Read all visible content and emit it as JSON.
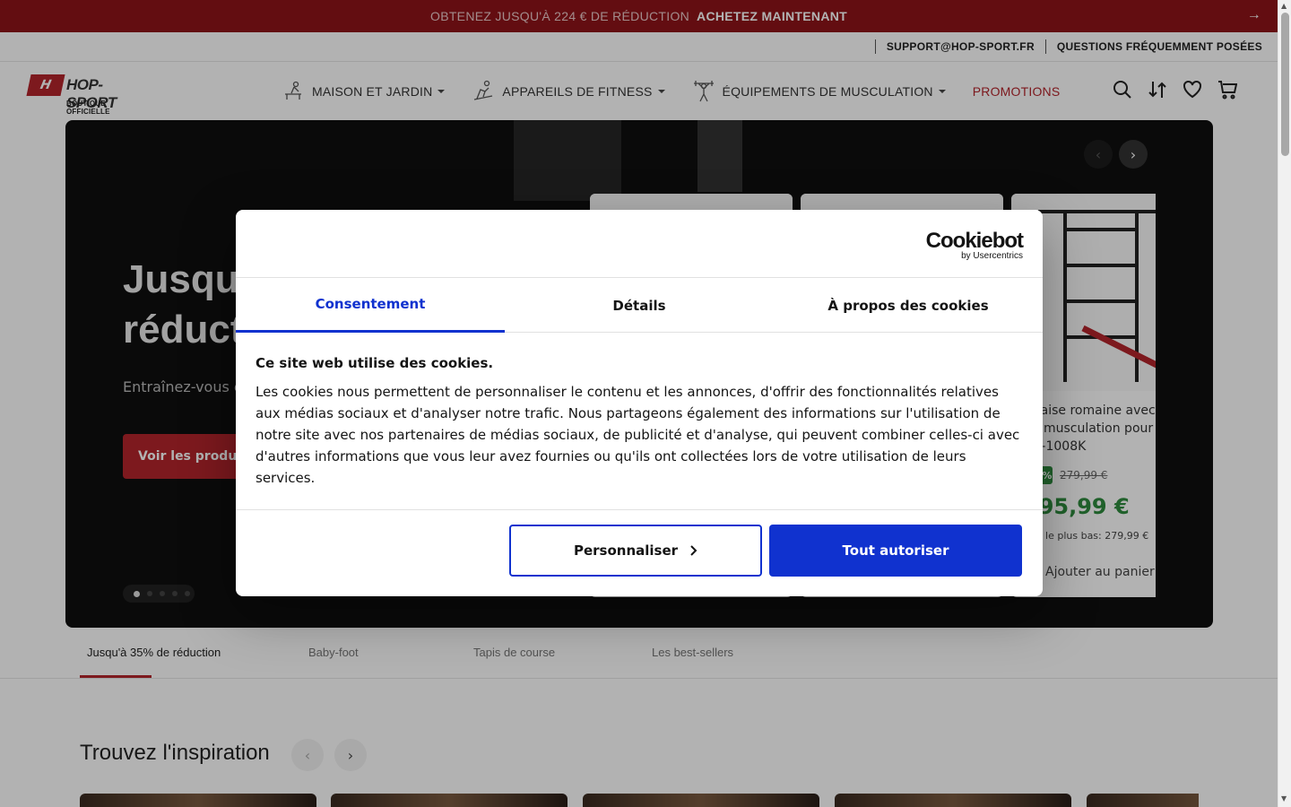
{
  "promo": {
    "lead": "OBTENEZ JUSQU'À 224 € DE RÉDUCTION",
    "cta": "ACHETEZ MAINTENANT",
    "arrow_icon": "arrow-right-icon"
  },
  "util": {
    "support": "SUPPORT@HOP-SPORT.FR",
    "faq": "QUESTIONS FRÉQUEMMENT POSÉES"
  },
  "logo": {
    "mark": "H",
    "name": "HOP-SPORT",
    "sub": "BOUTIQUE OFFICIELLE"
  },
  "nav": {
    "items": [
      {
        "label": "MAISON ET JARDIN",
        "icon": "bench-icon"
      },
      {
        "label": "APPAREILS DE FITNESS",
        "icon": "treadmill-icon"
      },
      {
        "label": "ÉQUIPEMENTS DE MUSCULATION",
        "icon": "weightlifter-icon"
      }
    ],
    "promotions": "PROMOTIONS"
  },
  "header_icons": [
    "search-icon",
    "compare-icon",
    "heart-icon",
    "cart-icon"
  ],
  "hero": {
    "title": "Jusqu'à 35% de réduction",
    "tagline": "Entraînez-vous e",
    "button": "Voir les produits",
    "slide_count": 5,
    "active_slide": 1,
    "card": {
      "title": "Chaise romaine avec barre de musculation pour abdos HS-1008K",
      "discount": "-30%",
      "old_price": "279,99 €",
      "price": "195,99 €",
      "lowest": "Prix le plus bas: 279,99 €",
      "add": "Ajouter au panier"
    }
  },
  "hero_tabs": [
    "Jusqu'à 35% de réduction",
    "Baby-foot",
    "Tapis de course",
    "Les best-sellers"
  ],
  "inspiration": {
    "title": "Trouvez l'inspiration"
  },
  "cookie": {
    "brand": "Cookiebot",
    "brand_sub": "by Usercentrics",
    "tabs": [
      "Consentement",
      "Détails",
      "À propos des cookies"
    ],
    "heading": "Ce site web utilise des cookies.",
    "body": "Les cookies nous permettent de personnaliser le contenu et les annonces, d'offrir des fonctionnalités relatives aux médias sociaux et d'analyser notre trafic. Nous partageons également des informations sur l'utilisation de notre site avec nos partenaires de médias sociaux, de publicité et d'analyse, qui peuvent combiner celles-ci avec d'autres informations que vous leur avez fournies ou qu'ils ont collectées lors de votre utilisation de leurs services.",
    "customize": "Personnaliser",
    "allow_all": "Tout autoriser"
  },
  "colors": {
    "brand_red": "#b3242b",
    "promo_bg": "#8e1419",
    "cookie_blue": "#1032cf",
    "price_green": "#2e8b3e"
  }
}
